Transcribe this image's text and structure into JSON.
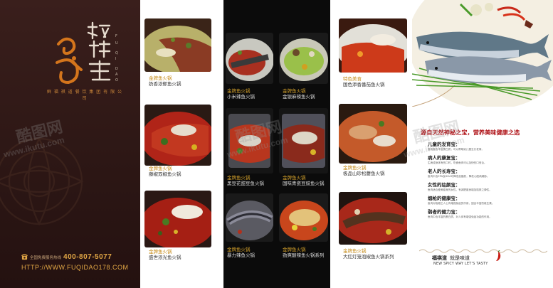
{
  "brand": {
    "name_cn": "福祺道",
    "pinyin": "FU QI DAO",
    "subtitle": "鲜 福 祺 道 餐 饮 集 团 有 限 公 司",
    "phone_label": "全国免费服务热线",
    "phone": "400-807-5077",
    "url": "HTTP://WWW.FUQIDAO178.COM"
  },
  "dishes_left": [
    {
      "line1": "金牌鱼火锅",
      "line2": "奶香浓郁鱼火锅"
    },
    {
      "line1": "金牌鱼火锅",
      "line2": "藤椒双椒鱼火锅"
    },
    {
      "line1": "金牌鱼火锅",
      "line2": "盛世浓光鱼火锅"
    }
  ],
  "dishes_middle": [
    {
      "line1": "金牌鱼火锅",
      "line2": "小米辣鱼火锅"
    },
    {
      "line1": "金牌鱼火锅",
      "line2": "金银麻辣鱼火锅"
    },
    {
      "line1": "金牌鱼火锅",
      "line2": "黑豆花甜豆鱼火锅"
    },
    {
      "line1": "金牌鱼火锅",
      "line2": "国味青瓷豆豉鱼火锅"
    },
    {
      "line1": "金牌鱼火锅",
      "line2": "暴力辣鱼火锅"
    },
    {
      "line1": "金牌鱼火锅",
      "line2": "劲爽酸辣鱼火锅系列"
    }
  ],
  "dishes_right": [
    {
      "line1": "特色美食",
      "line2": "国色添香番茄鱼火锅"
    },
    {
      "line1": "金牌鱼火锅",
      "line2": "极品山珍松蘑鱼火锅"
    },
    {
      "line1": "金牌鱼火锅",
      "line2": "大红灯笼泡椒鱼火锅系列"
    }
  ],
  "info": {
    "headline": "源自天然神秘之宝，营养美味健康之选",
    "benefits": [
      {
        "title": "儿童的发育宝：",
        "text": "鱼肉富含丰富蛋白质，可以帮助幼儿童生长发育。"
      },
      {
        "title": "病人的康复宝：",
        "text": "生病或身体有伤口时，吃食鱼肉可以加快伤口愈合。"
      },
      {
        "title": "老人的长寿宝：",
        "text": "鱼肉中含EPA及DHA可降低血脂肪，降低心脏病威胁。"
      },
      {
        "title": "女性的驻颜宝：",
        "text": "鱼肉适合爱美瘦身的女性，有减肥瘦身增加肌肤之弹性。"
      },
      {
        "title": "烟枪的健康宝：",
        "text": "鱼肉对吸烟之人士有增强免疫的作用，因含丰富的维生素。"
      },
      {
        "title": "弱者的健力宝：",
        "text": "鱼肉中含丰富的蛋白质，对人体有增强免疫功能的作用。"
      }
    ],
    "slogan_cn_1": "福祺道",
    "slogan_cn_2": "就是味道",
    "slogan_en": "NEW SPICY WAY LET'S TASTY"
  },
  "watermarks": [
    "酷图网",
    "www.ikutu.com",
    "酷图网",
    "www.ikutu.com",
    "酷图网",
    "www.ikutu.com"
  ],
  "colors": {
    "brand_dark": "#2d1715",
    "gold": "#e1a645",
    "headline_red": "#b0161b",
    "caption_gold": "#c58a16"
  }
}
